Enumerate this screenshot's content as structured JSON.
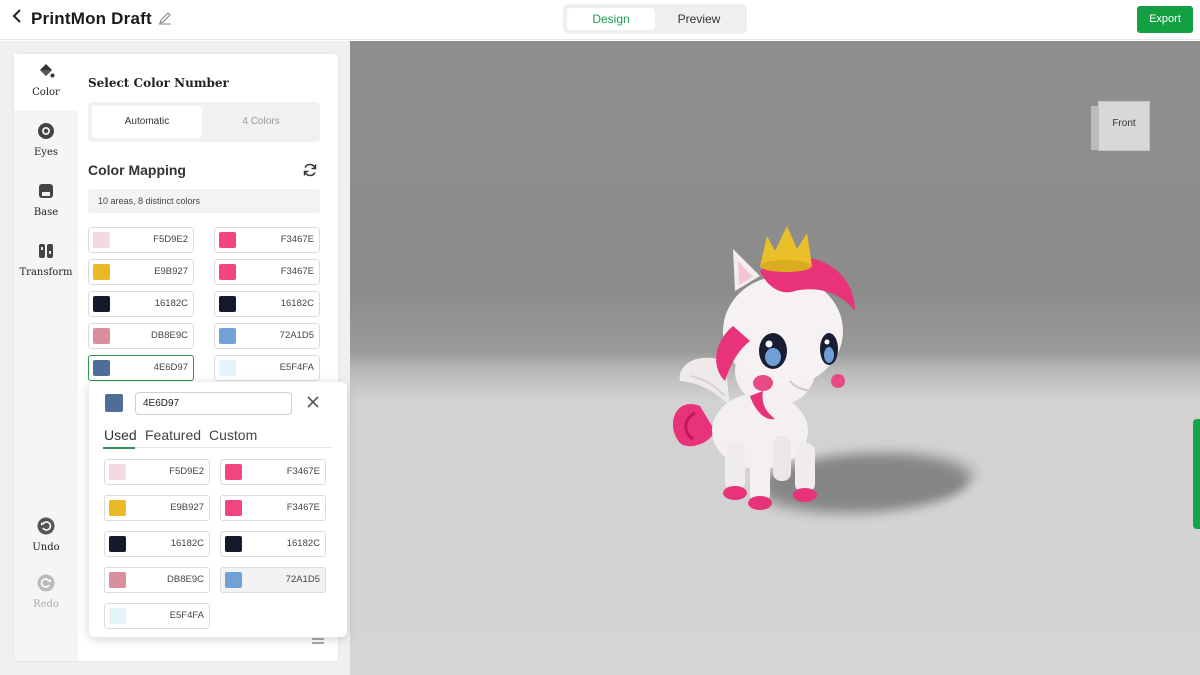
{
  "header": {
    "title": "PrintMon Draft",
    "modes": [
      "Design",
      "Preview"
    ],
    "active_mode": "Design",
    "export_label": "Export"
  },
  "rail": {
    "items": [
      {
        "label": "Color",
        "icon": "paint-bucket-icon"
      },
      {
        "label": "Eyes",
        "icon": "eye-icon"
      },
      {
        "label": "Base",
        "icon": "base-icon"
      },
      {
        "label": "Transform",
        "icon": "transform-icon"
      }
    ],
    "undo_label": "Undo",
    "redo_label": "Redo"
  },
  "panel": {
    "select_title": "Select Color Number",
    "options": [
      "Automatic",
      "4 Colors"
    ],
    "selected_option": "Automatic",
    "mapping_title": "Color Mapping",
    "mapping_info": "10 areas, 8 distinct colors",
    "mapping": [
      {
        "from": "#F5D9E2",
        "from_label": "F5D9E2",
        "to": "#F3467E",
        "to_label": "F3467E"
      },
      {
        "from": "#E9B927",
        "from_label": "E9B927",
        "to": "#F3467E",
        "to_label": "F3467E"
      },
      {
        "from": "#16182C",
        "from_label": "16182C",
        "to": "#16182C",
        "to_label": "16182C"
      },
      {
        "from": "#DB8E9C",
        "from_label": "DB8E9C",
        "to": "#72A1D5",
        "to_label": "72A1D5"
      },
      {
        "from": "#4E6D97",
        "from_label": "4E6D97",
        "to": "#E5F4FA",
        "to_label": "E5F4FA"
      }
    ]
  },
  "picker": {
    "current_color": "#4E6D97",
    "hex_value": "4E6D97",
    "tabs": [
      "Used",
      "Featured",
      "Custom"
    ],
    "active_tab": "Used",
    "used_colors": [
      {
        "color": "#F5D9E2",
        "label": "F5D9E2"
      },
      {
        "color": "#F3467E",
        "label": "F3467E"
      },
      {
        "color": "#E9B927",
        "label": "E9B927"
      },
      {
        "color": "#F3467E",
        "label": "F3467E"
      },
      {
        "color": "#16182C",
        "label": "16182C"
      },
      {
        "color": "#16182C",
        "label": "16182C"
      },
      {
        "color": "#DB8E9C",
        "label": "DB8E9C"
      },
      {
        "color": "#72A1D5",
        "label": "72A1D5"
      },
      {
        "color": "#E5F4FA",
        "label": "E5F4FA"
      }
    ]
  },
  "viewport": {
    "view_cube_label": "Front"
  },
  "colors": {
    "accent": "#13A042",
    "accent_text": "#1A9E4B"
  }
}
